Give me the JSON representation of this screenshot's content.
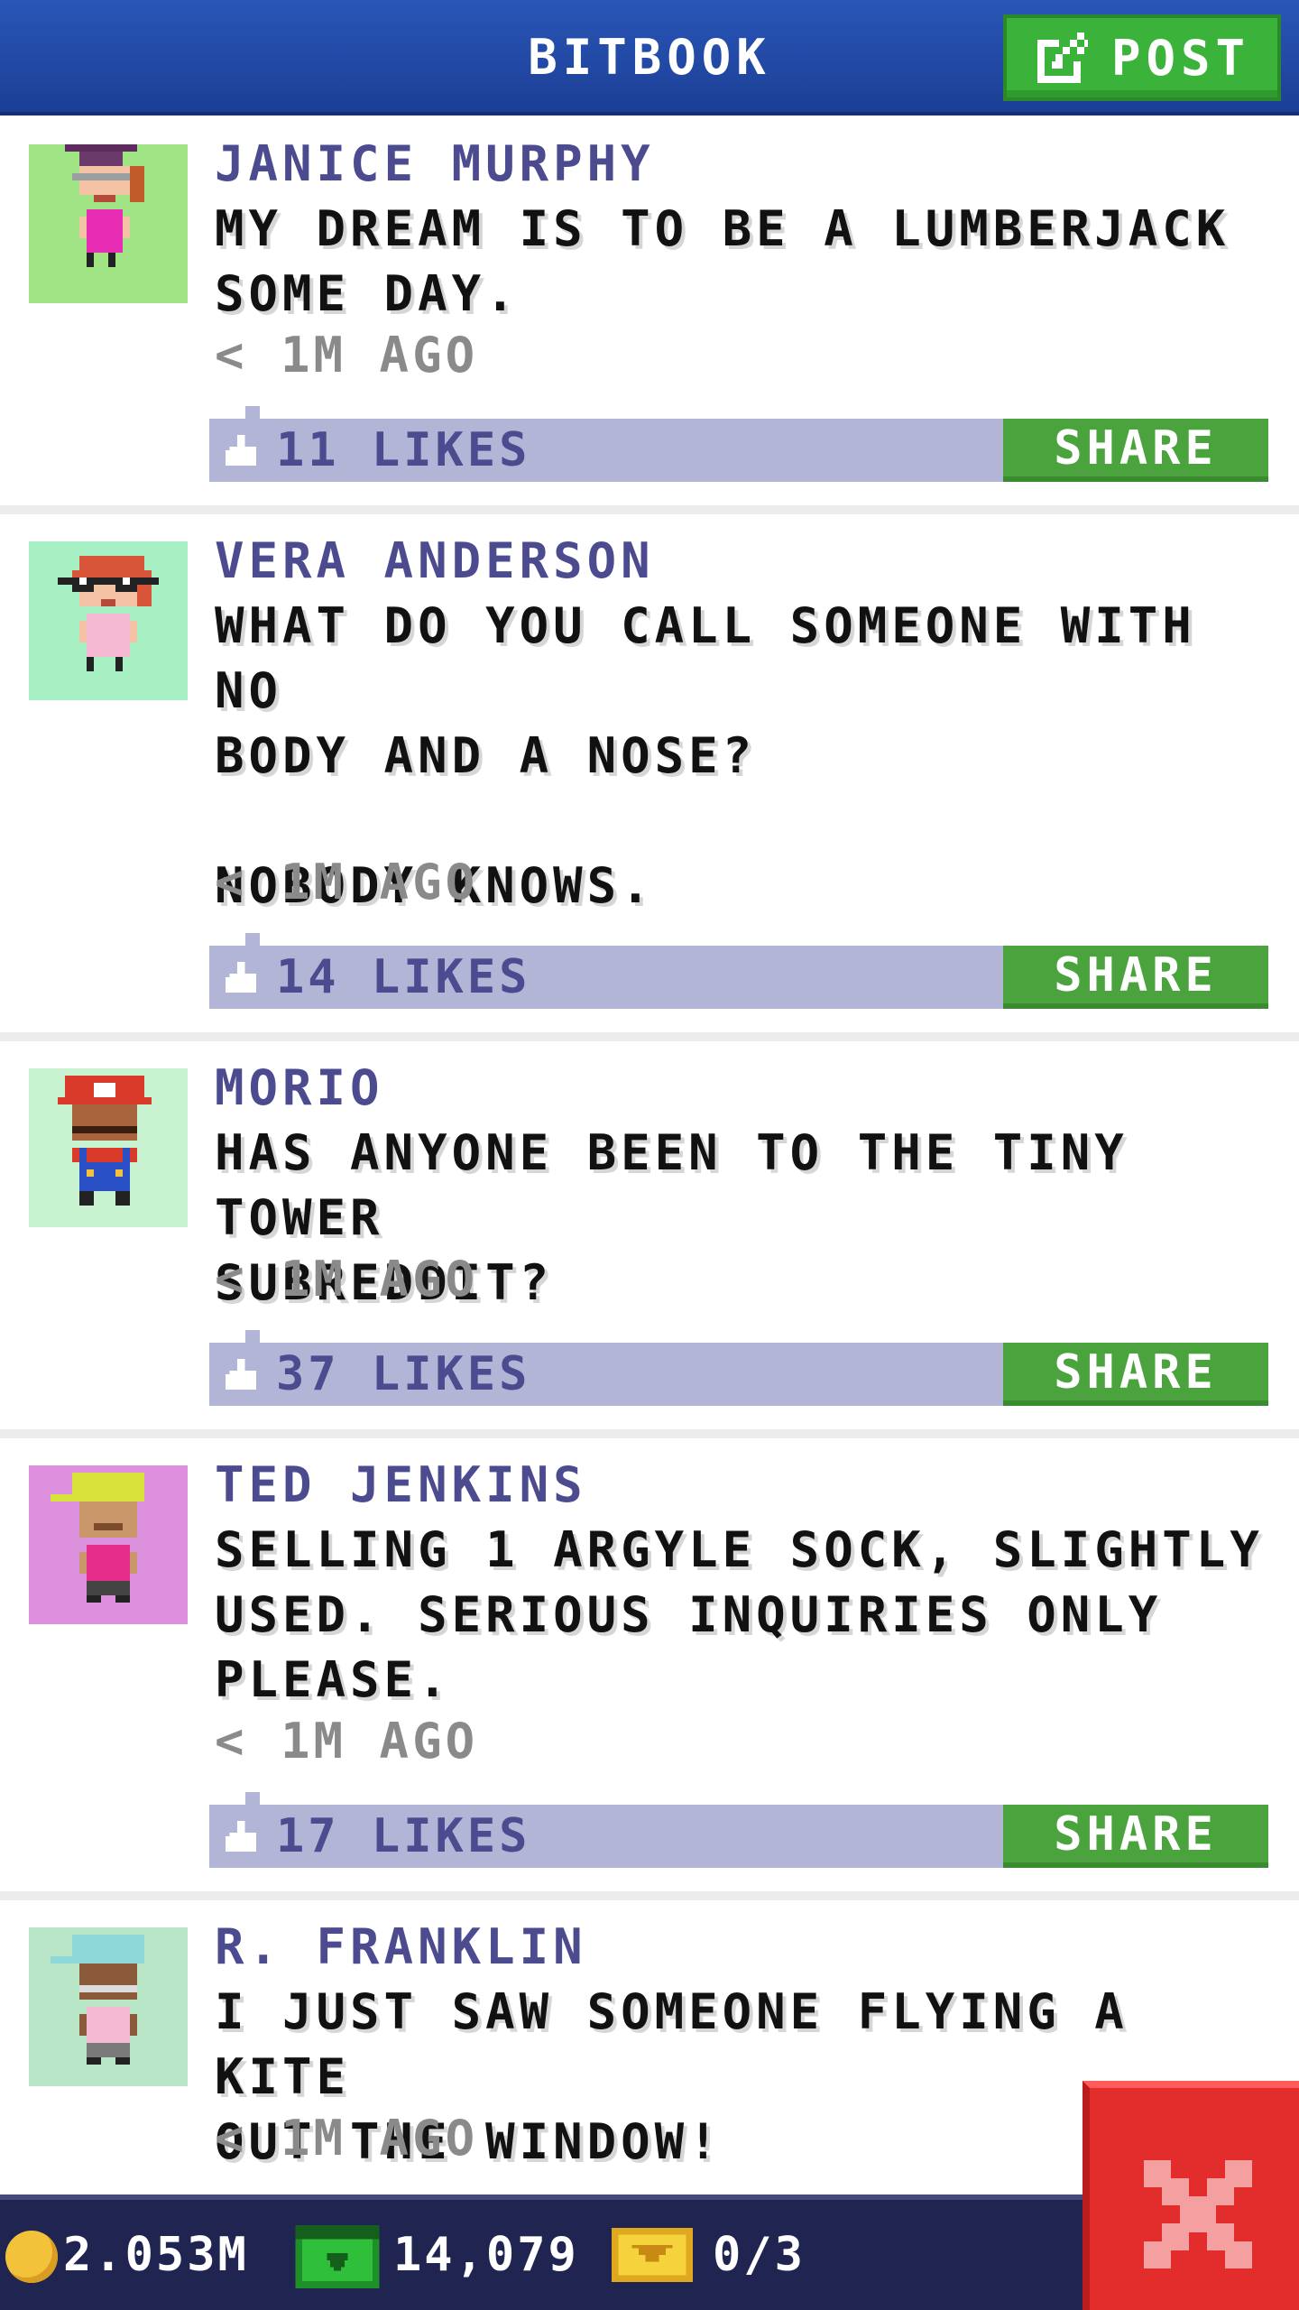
{
  "header": {
    "title": "BITBOOK",
    "post_label": "POST"
  },
  "posts": [
    {
      "author": "JANICE MURPHY",
      "message": "MY DREAM IS TO BE A LUMBERJACK\nSOME DAY.",
      "time": "< 1M AGO",
      "likes": "11 LIKES",
      "share_label": "SHARE",
      "avatar_bg": "#a1e485"
    },
    {
      "author": "VERA ANDERSON",
      "message": "WHAT DO YOU CALL SOMEONE WITH NO\nBODY AND A NOSE?\n\nNOBODY KNOWS.",
      "time": "< 1M AGO",
      "likes": "14 LIKES",
      "share_label": "SHARE",
      "avatar_bg": "#a6f0c3"
    },
    {
      "author": "MORIO",
      "message": "HAS ANYONE BEEN TO THE TINY TOWER\nSUBREDDIT?",
      "time": "< 1M AGO",
      "likes": "37 LIKES",
      "share_label": "SHARE",
      "avatar_bg": "#c6f2cf"
    },
    {
      "author": "TED JENKINS",
      "message": "SELLING 1 ARGYLE SOCK, SLIGHTLY\nUSED. SERIOUS INQUIRIES ONLY\nPLEASE.",
      "time": "< 1M AGO",
      "likes": "17 LIKES",
      "share_label": "SHARE",
      "avatar_bg": "#dc8fdc"
    },
    {
      "author": "R. FRANKLIN",
      "message": "I JUST SAW SOMEONE FLYING A KITE\nOUT THE WINDOW!",
      "time": "< 1M AGO",
      "avatar_bg": "#b8e6c6"
    }
  ],
  "status": {
    "coins": "2.053M",
    "bux": "14,079",
    "tickets": "0/3"
  },
  "colors": {
    "header_blue": "#2a56b8",
    "post_green": "#3bb33a",
    "like_bar": "#b3b5d6",
    "author_purple": "#4d4b8f",
    "close_red": "#e32c2c"
  },
  "icons": [
    "edit-icon",
    "thumb-up-icon",
    "coin-icon",
    "bux-icon",
    "ticket-icon",
    "close-icon"
  ]
}
